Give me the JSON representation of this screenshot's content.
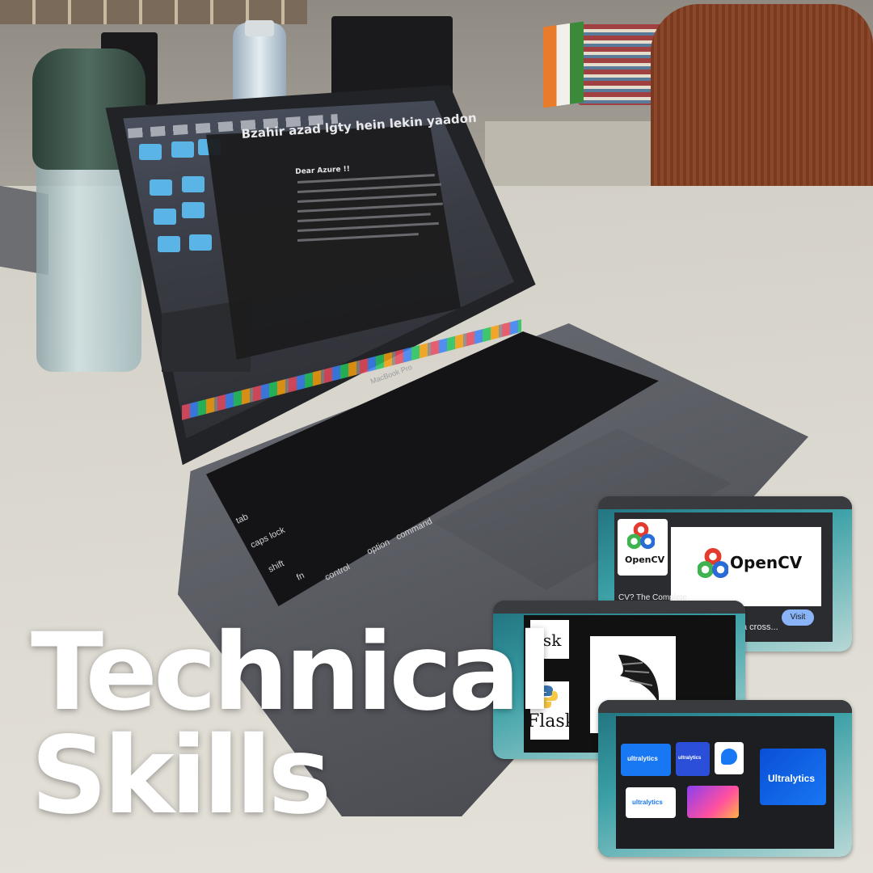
{
  "headline": {
    "line1": "Technical",
    "line2": "Skills"
  },
  "laptop": {
    "brand_label": "MacBook Pro",
    "note_title": "Bzahir azad lgty hein lekin yaadon",
    "note_heading": "Dear Azure !!",
    "keys": {
      "tab": "tab",
      "caps_lock": "caps lock",
      "shift": "shift",
      "fn": "fn",
      "control": "control",
      "option": "option",
      "command": "command"
    }
  },
  "screenshots": {
    "opencv": {
      "logo_text": "OpenCV",
      "thumb_text": "OpenCV",
      "caption": "CV? The Complete",
      "caption2": "a cross...",
      "button_label": "Visit"
    },
    "flask": {
      "word_top": "ask",
      "word_bottom": "Flask"
    },
    "ultralytics": {
      "tile1": "ultralytics",
      "tile2": "ultralytics",
      "tile3": "Ultralytics",
      "tile4": "ultralytics"
    }
  },
  "colors": {
    "headline": "#ffffff",
    "opencv_red": "#e33b2e",
    "opencv_green": "#3fb34f",
    "opencv_blue": "#2a6cd6",
    "ultralytics_blue": "#1877f2",
    "visit_button": "#8ab4f8"
  },
  "icons": [
    "opencv-logo-icon",
    "flask-horn-icon",
    "python-icon",
    "ultralytics-logo-icon",
    "apple-logo-icon"
  ]
}
